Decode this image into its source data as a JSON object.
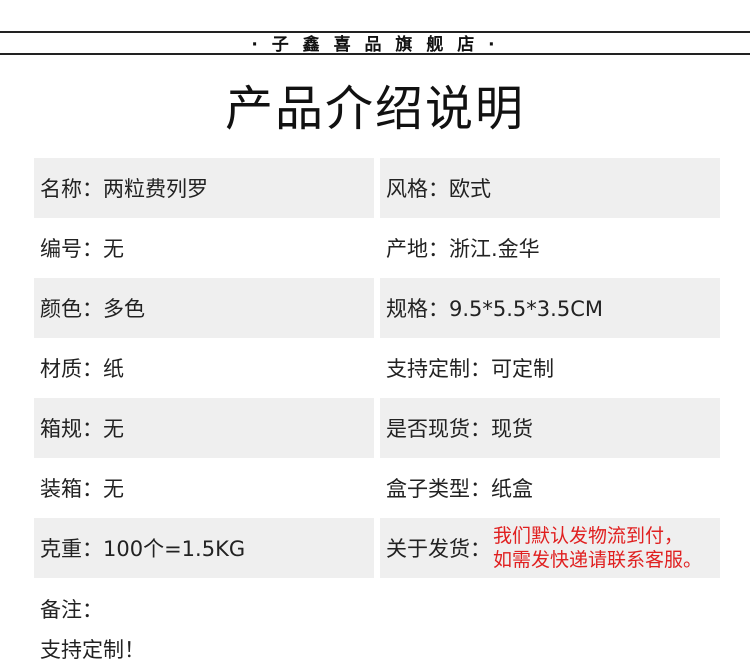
{
  "banner": {
    "store_name": "· 子 鑫 喜 品 旗 舰 店 ·"
  },
  "title": "产品介绍说明",
  "rows": [
    {
      "left": "名称：两粒费列罗",
      "right": "风格：欧式"
    },
    {
      "left": "编号：无",
      "right": "产地：浙江.金华"
    },
    {
      "left": "颜色：多色",
      "right": "规格：9.5*5.5*3.5CM"
    },
    {
      "left": "材质：纸",
      "right": "支持定制：可定制"
    },
    {
      "left": "箱规：无",
      "right": "是否现货：现货"
    },
    {
      "left": "装箱：无",
      "right": "盒子类型：纸盒"
    },
    {
      "left": "克重：100个=1.5KG",
      "right": "关于发货："
    }
  ],
  "shipping_note": {
    "line1": "我们默认发物流到付，",
    "line2": "如需发快递请联系客服。"
  },
  "remarks": {
    "label": "备注：",
    "text": "支持定制！"
  },
  "colors": {
    "row_shade": "#efefef",
    "note_red": "#e02020"
  }
}
